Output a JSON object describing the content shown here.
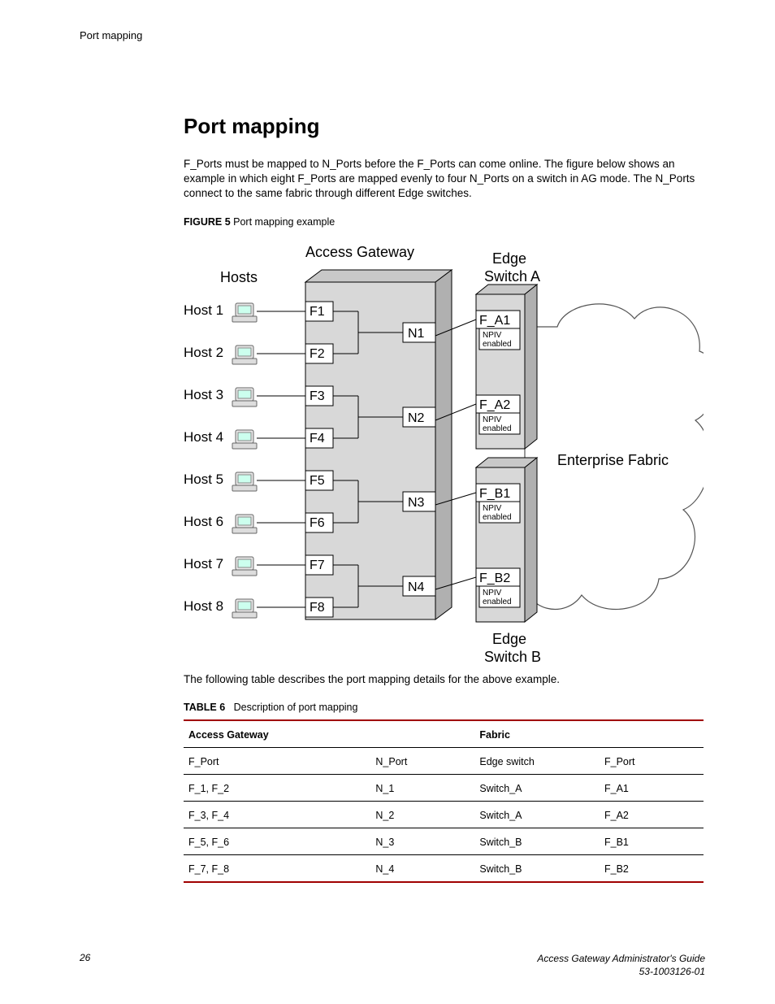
{
  "header": {
    "breadcrumb": "Port mapping"
  },
  "section": {
    "title": "Port mapping",
    "intro": "F_Ports must be mapped to N_Ports before the F_Ports can come online. The figure below shows an example in which eight F_Ports are mapped evenly to four N_Ports on a switch in AG mode. The N_Ports connect to the same fabric through different Edge switches.",
    "figure_label": "FIGURE 5",
    "figure_caption": "Port mapping example",
    "after_figure": "The following table describes the port mapping details for the above example.",
    "table_label": "TABLE 6",
    "table_caption": "Description of port mapping"
  },
  "diagram": {
    "hosts_label": "Hosts",
    "access_gateway_label": "Access Gateway",
    "edge_switch_a_label": "Edge\nSwitch A",
    "edge_switch_b_label": "Edge\nSwitch B",
    "enterprise_fabric_label": "Enterprise Fabric",
    "hosts": [
      "Host 1",
      "Host 2",
      "Host 3",
      "Host 4",
      "Host 5",
      "Host 6",
      "Host 7",
      "Host 8"
    ],
    "fports": [
      "F1",
      "F2",
      "F3",
      "F4",
      "F5",
      "F6",
      "F7",
      "F8"
    ],
    "nports": [
      "N1",
      "N2",
      "N3",
      "N4"
    ],
    "edge_ports": [
      {
        "label": "F_A1",
        "sub": "NPIV\nenabled"
      },
      {
        "label": "F_A2",
        "sub": "NPIV\nenabled"
      },
      {
        "label": "F_B1",
        "sub": "NPIV\nenabled"
      },
      {
        "label": "F_B2",
        "sub": "NPIV\nenabled"
      }
    ]
  },
  "table": {
    "group_headers": [
      "Access Gateway",
      "Fabric"
    ],
    "columns": [
      "F_Port",
      "N_Port",
      "Edge switch",
      "F_Port"
    ],
    "rows": [
      [
        "F_1, F_2",
        "N_1",
        "Switch_A",
        "F_A1"
      ],
      [
        "F_3, F_4",
        "N_2",
        "Switch_A",
        "F_A2"
      ],
      [
        "F_5, F_6",
        "N_3",
        "Switch_B",
        "F_B1"
      ],
      [
        "F_7, F_8",
        "N_4",
        "Switch_B",
        "F_B2"
      ]
    ]
  },
  "footer": {
    "page": "26",
    "doc_title": "Access Gateway Administrator's Guide",
    "doc_number": "53-1003126-01"
  }
}
